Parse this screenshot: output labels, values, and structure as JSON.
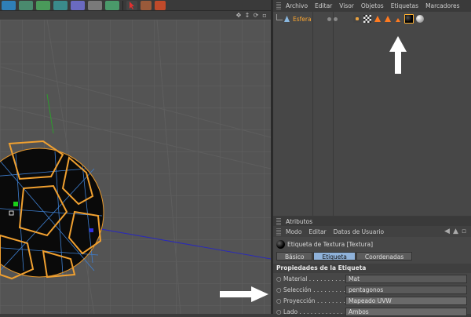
{
  "object_manager": {
    "menu": [
      "Archivo",
      "Editar",
      "Visor",
      "Objetos",
      "Etiquetas",
      "Marcadores"
    ],
    "object_name": "Esfera"
  },
  "attributes": {
    "panel_title": "Atributos",
    "menu": [
      "Modo",
      "Editar",
      "Datos de Usuario"
    ],
    "tag_title": "Etiqueta de Textura [Textura]",
    "tabs": [
      "Básico",
      "Etiqueta",
      "Coordenadas"
    ],
    "active_tab": "Etiqueta",
    "section_title": "Propiedades de la Etiqueta",
    "properties": [
      {
        "label": "Material",
        "value": "Mat"
      },
      {
        "label": "Selección",
        "value": "pentagonos"
      },
      {
        "label": "Proyección",
        "value": "Mapeado UVW"
      },
      {
        "label": "Lado",
        "value": "Ambos"
      }
    ]
  },
  "colors": {
    "selection_orange": "#ffa830",
    "active_tab": "#8fb2da",
    "viewport_bg": "#545454"
  }
}
